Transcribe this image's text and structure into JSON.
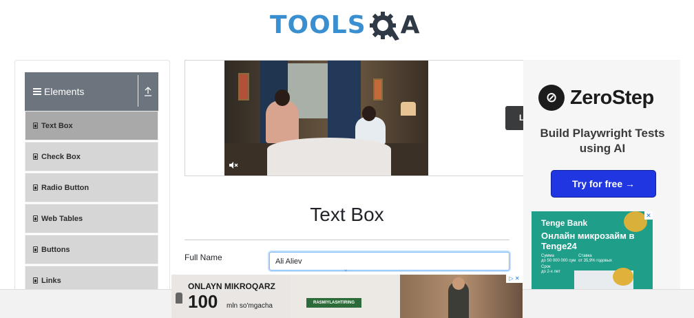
{
  "header": {
    "logo_text_1": "TOOLS",
    "logo_text_2": "A",
    "logo_icon": "gear-q-icon"
  },
  "sidebar": {
    "group_title": "Elements",
    "group_icon": "menu-icon",
    "collapse_icon": "collapse-up-icon",
    "items": [
      {
        "label": "Text Box",
        "active": true
      },
      {
        "label": "Check Box",
        "active": false
      },
      {
        "label": "Radio Button",
        "active": false
      },
      {
        "label": "Web Tables",
        "active": false
      },
      {
        "label": "Buttons",
        "active": false
      },
      {
        "label": "Links",
        "active": false
      }
    ]
  },
  "video_ad": {
    "mute_icon": "muted-speaker-icon",
    "side_button_label": "L"
  },
  "main": {
    "title": "Text Box",
    "full_name_label": "Full Name",
    "full_name_value": "Ali Aliev"
  },
  "right_ad": {
    "brand": "ZeroStep",
    "tagline": "Build Playwright Tests using AI",
    "cta": "Try for free →",
    "accent_color": "#1f36e0"
  },
  "tenge_ad": {
    "brand": "Tenge Bank",
    "headline": "Онлайн микрозайм в Tenge24",
    "sum_label": "Сумма",
    "sum_value": "до 50 000 000 сум",
    "rate_label": "Ставка",
    "rate_value": "от 35,9% годовых",
    "term_label": "Срок",
    "term_value": "до 2-х лет",
    "close": "✕"
  },
  "bottom_ad": {
    "title": "ONLAYN MIKROQARZ",
    "amount": "100",
    "unit": "mln so'mgacha",
    "cta": "RASMIYLASHTIRING",
    "close": "▷ ✕"
  }
}
